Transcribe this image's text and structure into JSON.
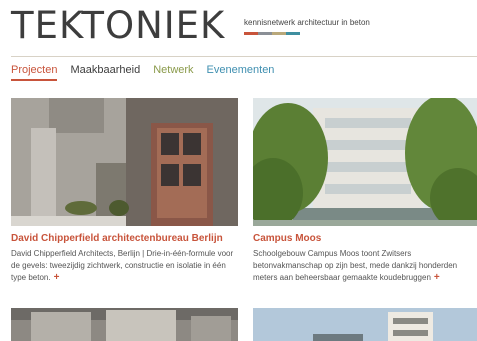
{
  "header": {
    "logo": "TEKTONIEK",
    "tagline": "kennisnetwerk architectuur in beton",
    "stripe_colors": [
      "#c8543b",
      "#8a8f96",
      "#b9a87a",
      "#3f8fa0"
    ]
  },
  "nav": {
    "items": [
      {
        "label": "Projecten",
        "color": "#c8543b",
        "active": true
      },
      {
        "label": "Maakbaarheid",
        "color": "#3d3d3d",
        "active": false
      },
      {
        "label": "Netwerk",
        "color": "#8a9a4a",
        "active": false
      },
      {
        "label": "Evenementen",
        "color": "#3f8fb0",
        "active": false
      }
    ]
  },
  "cards": [
    {
      "title": "David Chipperfield architectenbureau Berlijn",
      "description": "David Chipperfield Architects, Berlijn | Drie-in-één-formule voor de gevels: tweezijdig zichtwerk, constructie en isolatie in één type beton.",
      "more": "+"
    },
    {
      "title": "Campus Moos",
      "description": "Schoolgebouw Campus Moos toont Zwitsers betonvakmanschap op zijn best, mede dankzij honderden meters aan beheersbaar gemaakte koudebruggen",
      "more": "+"
    }
  ],
  "accent_color": "#c8543b"
}
